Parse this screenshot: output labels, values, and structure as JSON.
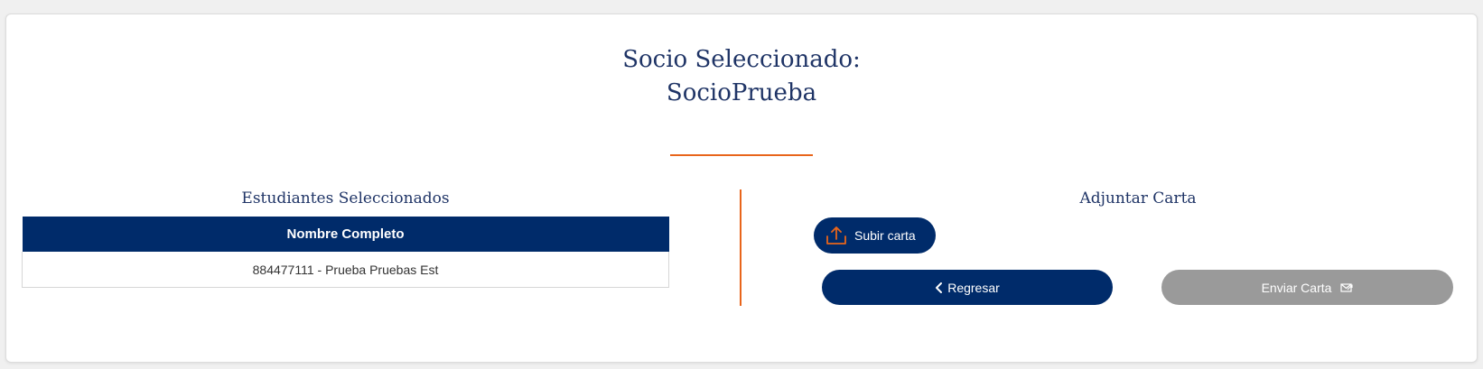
{
  "header": {
    "title_line1": "Socio Seleccionado:",
    "title_line2": "SocioPrueba"
  },
  "students": {
    "title": "Estudiantes Seleccionados",
    "table": {
      "columns": [
        "Nombre Completo"
      ],
      "rows": [
        [
          "884477111 - Prueba Pruebas Est"
        ]
      ]
    }
  },
  "attach": {
    "title": "Adjuntar Carta",
    "upload_label": "Subir carta",
    "upload_icon": "upload-icon"
  },
  "actions": {
    "back_label": "Regresar",
    "back_icon": "chevron-left-icon",
    "send_label": "Enviar Carta",
    "send_icon": "mail-send-icon"
  },
  "colors": {
    "primary": "#002b6a",
    "accent": "#e8651b",
    "disabled": "#9a9a9a",
    "title_text": "#1f3466"
  }
}
